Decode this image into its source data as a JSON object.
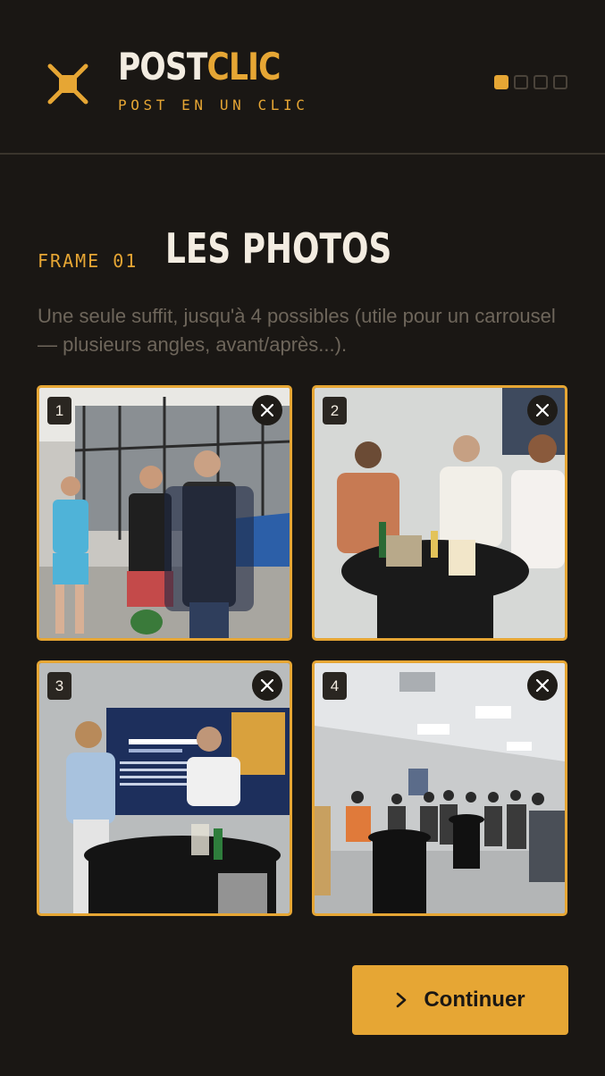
{
  "brand": {
    "part1": "POST",
    "part2": "CLIC",
    "tagline": "POST EN UN CLIC"
  },
  "progress": {
    "current_step": 1,
    "total_steps": 4
  },
  "section": {
    "frame_label": "FRAME 01",
    "title": "LES PHOTOS",
    "description": "Une seule suffit, jusqu'à 4 possibles (utile pour un carrousel — plusieurs angles, avant/après...)."
  },
  "photos": [
    {
      "index": "1",
      "remove_icon": "close-icon"
    },
    {
      "index": "2",
      "remove_icon": "close-icon"
    },
    {
      "index": "3",
      "remove_icon": "close-icon"
    },
    {
      "index": "4",
      "remove_icon": "close-icon"
    }
  ],
  "actions": {
    "continue_label": "Continuer",
    "continue_icon": "chevron-right-icon"
  },
  "colors": {
    "background": "#1a1714",
    "accent": "#e6a634",
    "text": "#f3ece1",
    "muted": "#6e665b"
  }
}
